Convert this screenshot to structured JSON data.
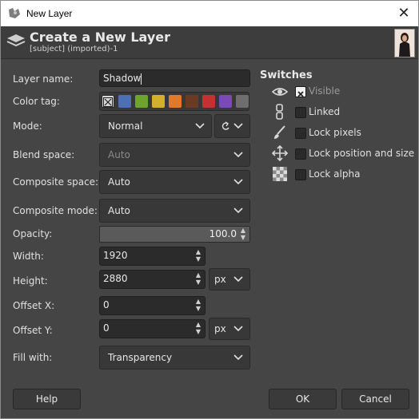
{
  "window": {
    "title": "New Layer",
    "close_glyph": "✕"
  },
  "header": {
    "title": "Create a New Layer",
    "subtitle": "[subject] (imported)-1"
  },
  "form": {
    "layer_name_label": "Layer name:",
    "layer_name_value": "Shadow",
    "color_tag_label": "Color tag:",
    "color_tags": [
      "none",
      "#4d6fb5",
      "#6ea32e",
      "#d4b028",
      "#e07a2a",
      "#6b3a22",
      "#c73030",
      "#7a4ab8",
      "#6e6e6e"
    ],
    "mode_label": "Mode:",
    "mode_value": "Normal",
    "blend_space_label": "Blend space:",
    "blend_space_value": "Auto",
    "composite_space_label": "Composite space:",
    "composite_space_value": "Auto",
    "composite_mode_label": "Composite mode:",
    "composite_mode_value": "Auto",
    "opacity_label": "Opacity:",
    "opacity_value": "100.0",
    "width_label": "Width:",
    "width_value": "1920",
    "height_label": "Height:",
    "height_value": "2880",
    "size_unit": "px",
    "offset_x_label": "Offset X:",
    "offset_x_value": "0",
    "offset_y_label": "Offset Y:",
    "offset_y_value": "0",
    "offset_unit": "px",
    "fill_label": "Fill with:",
    "fill_value": "Transparency"
  },
  "switches": {
    "title": "Switches",
    "items": [
      {
        "label": "Visible",
        "icon": "eye-icon",
        "checked": true
      },
      {
        "label": "Linked",
        "icon": "chain-icon",
        "checked": false
      },
      {
        "label": "Lock pixels",
        "icon": "paintbrush-icon",
        "checked": false
      },
      {
        "label": "Lock position and size",
        "icon": "move-icon",
        "checked": false
      },
      {
        "label": "Lock alpha",
        "icon": "checkerboard-icon",
        "checked": false
      }
    ]
  },
  "buttons": {
    "help": "Help",
    "ok": "OK",
    "cancel": "Cancel"
  },
  "colors": {
    "background": "#454545",
    "entry": "#2b2b2b",
    "text": "#e0e0e0"
  }
}
